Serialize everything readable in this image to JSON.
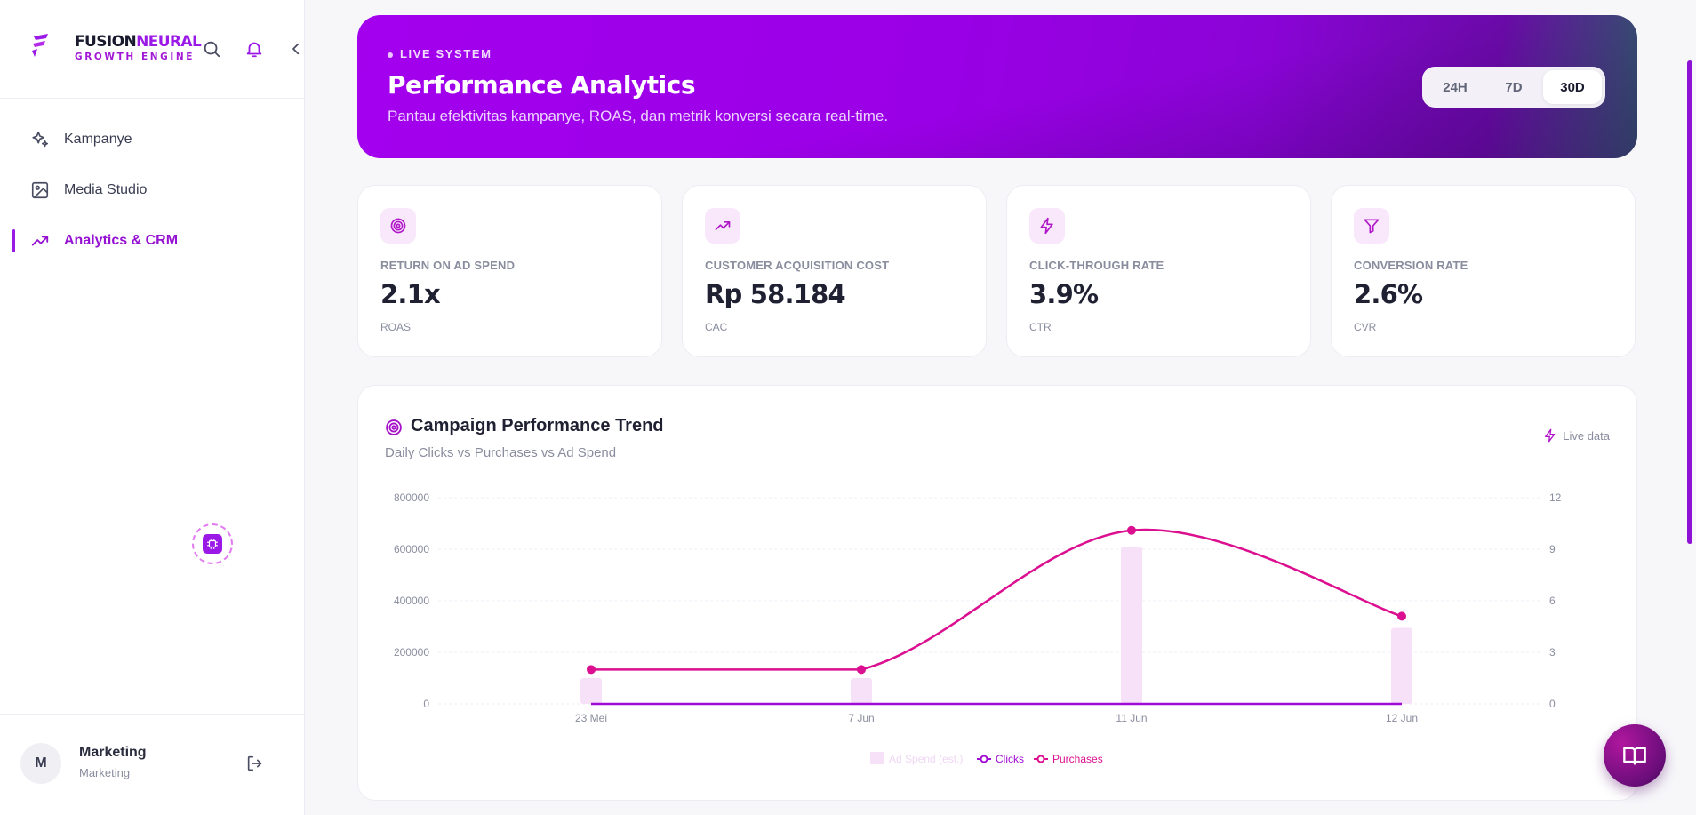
{
  "brand": {
    "name_part1": "FUSION",
    "name_part2": "NEURAL",
    "subtitle": "GROWTH ENGINE",
    "accent_color": "#9b19e6"
  },
  "sidebar": {
    "items": [
      {
        "label": "Kampanye",
        "icon": "sparkles-icon",
        "active": false
      },
      {
        "label": "Media Studio",
        "icon": "image-icon",
        "active": false
      },
      {
        "label": "Analytics & CRM",
        "icon": "trending-up-icon",
        "active": true
      }
    ]
  },
  "user": {
    "initial": "M",
    "name": "Marketing",
    "role": "Marketing"
  },
  "hero": {
    "tag": "LIVE SYSTEM",
    "title": "Performance Analytics",
    "description": "Pantau efektivitas kampanye, ROAS, dan metrik konversi secara real-time.",
    "ranges": [
      "24H",
      "7D",
      "30D"
    ],
    "selected_range": "30D"
  },
  "kpis": [
    {
      "label": "RETURN ON AD SPEND",
      "value": "2.1x",
      "sub": "ROAS",
      "icon": "target-icon"
    },
    {
      "label": "CUSTOMER ACQUISITION COST",
      "value": "Rp 58.184",
      "sub": "CAC",
      "icon": "trending-up-icon"
    },
    {
      "label": "CLICK-THROUGH RATE",
      "value": "3.9%",
      "sub": "CTR",
      "icon": "zap-icon"
    },
    {
      "label": "CONVERSION RATE",
      "value": "2.6%",
      "sub": "CVR",
      "icon": "filter-icon"
    }
  ],
  "chart_card": {
    "title": "Campaign Performance Trend",
    "subtitle": "Daily Clicks vs Purchases vs Ad Spend",
    "live_label": "Live data"
  },
  "chart_data": {
    "type": "bar",
    "categories": [
      "23 Mei",
      "7 Jun",
      "11 Jun",
      "12 Jun"
    ],
    "y_left": {
      "ticks": [
        "800000",
        "600000",
        "400000",
        "200000",
        "0"
      ],
      "lim": [
        0,
        800000
      ]
    },
    "y_right": {
      "ticks": [
        "12",
        "9",
        "6",
        "3",
        "0"
      ],
      "lim": [
        0,
        12
      ]
    },
    "series": [
      {
        "name": "Ad Spend (est.)",
        "type": "bar",
        "axis": "left",
        "color": "#f7e1f8",
        "values": [
          100000,
          100000,
          610000,
          295000
        ]
      },
      {
        "name": "Clicks",
        "type": "line",
        "axis": "left",
        "color": "#a10bd6",
        "values": [
          0,
          0,
          0,
          0
        ]
      },
      {
        "name": "Purchases",
        "type": "line",
        "axis": "right",
        "color": "#db0f8f",
        "values": [
          2,
          2,
          10.1,
          5.1
        ]
      }
    ],
    "grid": true,
    "legend": "bottom-center"
  }
}
